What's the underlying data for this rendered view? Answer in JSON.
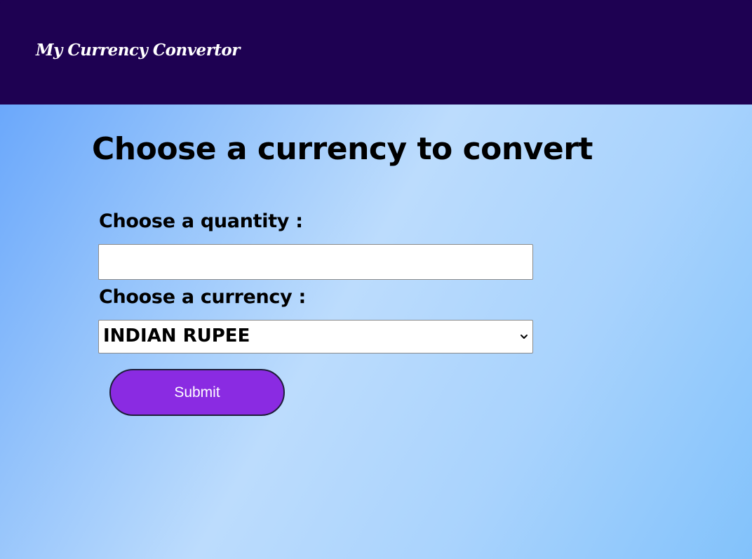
{
  "header": {
    "brand": "My Currency Convertor"
  },
  "main": {
    "title": "Choose a currency to convert",
    "quantity_label": "Choose a quantity :",
    "quantity_value": "",
    "quantity_placeholder": "",
    "currency_label": "Choose a currency :",
    "currency_selected": "INDIAN RUPEE",
    "submit_label": "Submit"
  },
  "icons": {
    "dropdown": "chevron-down-icon"
  },
  "colors": {
    "header_bg": "#1e0152",
    "button_bg": "#8a2be2",
    "gradient_light": "#bcdcfd",
    "gradient_dark": "#6ba8fb"
  }
}
